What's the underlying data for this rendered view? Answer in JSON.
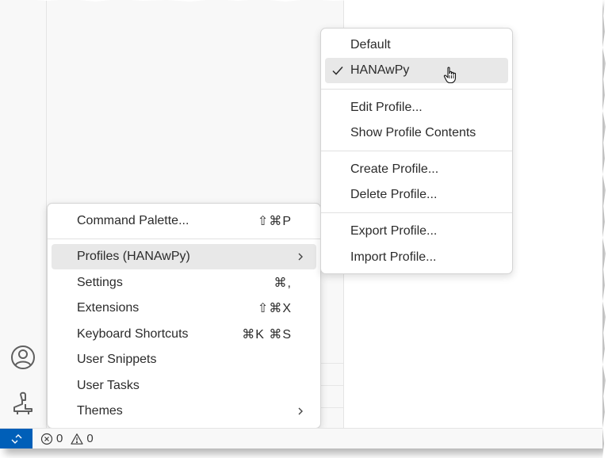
{
  "manage_menu": {
    "items": [
      {
        "label": "Command Palette...",
        "shortcut": "⇧⌘P"
      },
      {
        "label": "Profiles (HANAwPy)",
        "submenu": true
      },
      {
        "label": "Settings",
        "shortcut": "⌘,"
      },
      {
        "label": "Extensions",
        "shortcut": "⇧⌘X"
      },
      {
        "label": "Keyboard Shortcuts",
        "shortcut": "⌘K ⌘S"
      },
      {
        "label": "User Snippets"
      },
      {
        "label": "User Tasks"
      },
      {
        "label": "Themes",
        "submenu": true
      }
    ]
  },
  "profiles_menu": {
    "items": [
      {
        "label": "Default"
      },
      {
        "label": "HANAwPy",
        "checked": true
      },
      {
        "label": "Edit Profile..."
      },
      {
        "label": "Show Profile Contents"
      },
      {
        "label": "Create Profile..."
      },
      {
        "label": "Delete Profile..."
      },
      {
        "label": "Export Profile..."
      },
      {
        "label": "Import Profile..."
      }
    ]
  },
  "status_bar": {
    "errors": "0",
    "warnings": "0"
  },
  "activity_bar": {
    "icons": [
      "accounts-icon",
      "manage-icon"
    ]
  },
  "colors": {
    "accent": "#005fb8",
    "menu_highlight": "#e8e8e8"
  }
}
